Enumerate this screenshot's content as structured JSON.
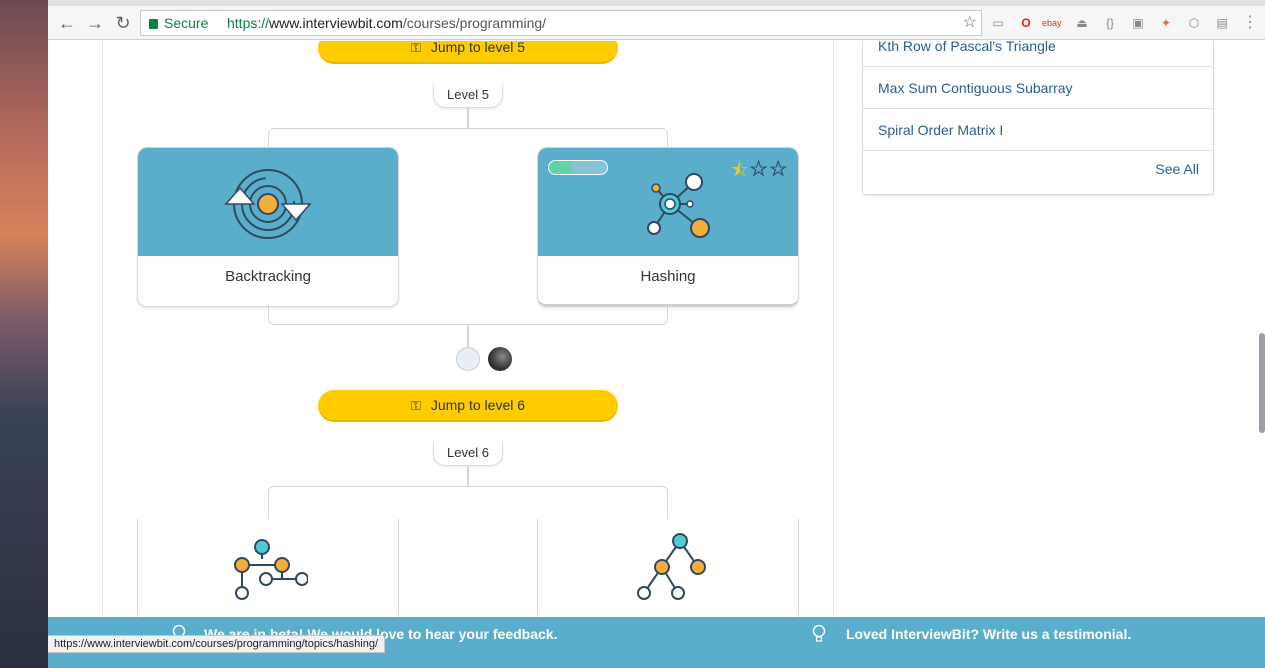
{
  "browser": {
    "secure_label": "Secure",
    "url_scheme": "https://",
    "url_host": "www.interviewbit.com",
    "url_path": "/courses/programming/"
  },
  "levels": [
    {
      "jump_label": "Jump to level 5",
      "level_label": "Level 5"
    },
    {
      "jump_label": "Jump to level 6",
      "level_label": "Level 6"
    }
  ],
  "topics": [
    {
      "label": "Backtracking",
      "icon": "backtracking-icon"
    },
    {
      "label": "Hashing",
      "icon": "hashing-icon",
      "progress": 0.4,
      "stars_filled": 0.5,
      "stars_total": 3
    }
  ],
  "sidebar": {
    "problems": [
      "Kth Row of Pascal's Triangle",
      "Max Sum Contiguous Subarray",
      "Spiral Order Matrix I"
    ],
    "see_all": "See All"
  },
  "footer": {
    "beta_text": "We are in beta! We would love to hear your feedback.",
    "testimonial_text": "Loved InterviewBit? Write us a testimonial."
  },
  "status_bar": {
    "hover_url": "https://www.interviewbit.com/courses/programming/topics/hashing/"
  },
  "colors": {
    "accent_yellow": "#ffcc00",
    "card_blue": "#5aaecb",
    "link_blue": "#2c5d8f",
    "node_orange": "#f6ad3b",
    "node_cyan": "#4fc9d6"
  }
}
